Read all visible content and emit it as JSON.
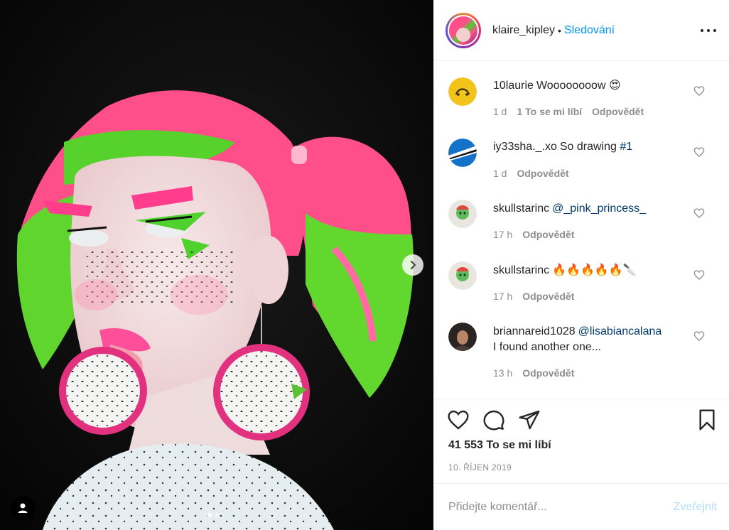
{
  "post": {
    "username": "klaire_kipley",
    "separator": "•",
    "follow_label": "Sledování",
    "more_options": "more-icon",
    "media": {
      "carousel_index": 1,
      "carousel_count": 2
    },
    "likes_text": "41 553 To se mi líbí",
    "date": "10. ŘÍJEN 2019"
  },
  "comments": [
    {
      "username": "10laurie",
      "text": "Woooooooow",
      "emoji": "😍",
      "age": "1 d",
      "likes": "1 To se mi líbí",
      "reply": "Odpovědět"
    },
    {
      "username": "iy33sha._.xo",
      "text": "So drawing ",
      "hashtag": "#1",
      "age": "1 d",
      "reply": "Odpovědět"
    },
    {
      "username": "skullstarinc",
      "mention": "@_pink_princess_",
      "age": "17 h",
      "reply": "Odpovědět"
    },
    {
      "username": "skullstarinc",
      "text": "🔥🔥🔥🔥🔥🔪",
      "age": "17 h",
      "reply": "Odpovědět"
    },
    {
      "username": "briannareid1028",
      "mention": "@lisabiancalana",
      "text2": "I found another one...",
      "age": "13 h",
      "reply": "Odpovědět"
    }
  ],
  "composer": {
    "placeholder": "Přidejte komentář...",
    "post_label": "Zveřejnit"
  },
  "colors": {
    "accent": "#0095f6",
    "muted": "#8e8e8e",
    "mention": "#00376b",
    "post_disabled": "#b2dffc"
  }
}
